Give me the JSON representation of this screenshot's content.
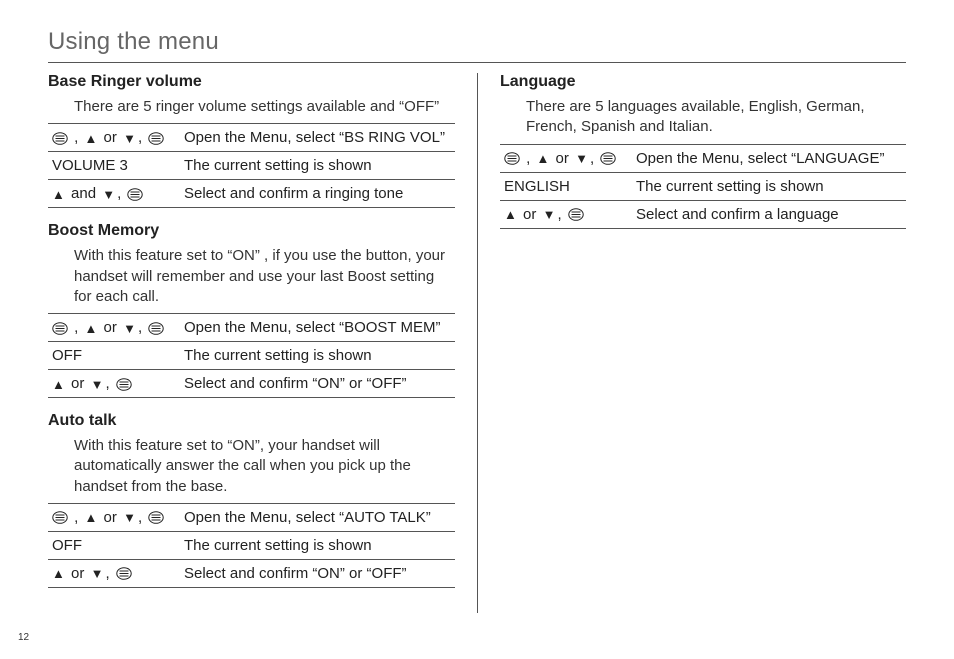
{
  "title": "Using the menu",
  "page_number": "12",
  "left": {
    "sections": [
      {
        "heading": "Base Ringer volume",
        "desc": "There are 5 ringer volume settings available and “OFF”",
        "rows": [
          {
            "key_pattern": "menu-updown-menu",
            "action": "Open the Menu, select “BS RING VOL”"
          },
          {
            "key_text": "VOLUME 3",
            "action": "The current setting is shown"
          },
          {
            "key_pattern": "up-and-down-menu",
            "action": "Select and confirm a ringing tone"
          }
        ]
      },
      {
        "heading": "Boost Memory",
        "desc": "With this feature set to “ON” , if you use the button, your handset will remember and use your last Boost setting for each call.",
        "rows": [
          {
            "key_pattern": "menu-updown-menu",
            "action": "Open the Menu, select “BOOST MEM”"
          },
          {
            "key_text": "OFF",
            "action": "The current setting is shown"
          },
          {
            "key_pattern": "updown-menu",
            "action": "Select and confirm “ON” or “OFF”"
          }
        ]
      },
      {
        "heading": "Auto talk",
        "desc": "With this feature set to “ON”, your handset will automatically answer the call when you pick up the handset from the base.",
        "rows": [
          {
            "key_pattern": "menu-updown-menu",
            "action": "Open the Menu, select “AUTO TALK”"
          },
          {
            "key_text": "OFF",
            "action": "The current setting is shown"
          },
          {
            "key_pattern": "updown-menu",
            "action": "Select and confirm “ON” or “OFF”"
          }
        ]
      }
    ]
  },
  "right": {
    "sections": [
      {
        "heading": "Language",
        "desc": "There are 5 languages available, English, German, French, Spanish and Italian.",
        "rows": [
          {
            "key_pattern": "menu-updown-menu",
            "action": "Open the Menu, select “LANGUAGE”"
          },
          {
            "key_text": "ENGLISH",
            "action": "The current setting is shown"
          },
          {
            "key_pattern": "updown-menu",
            "action": "Select and confirm a language"
          }
        ]
      }
    ]
  },
  "labels": {
    "or": "or",
    "and": "and",
    "comma": ","
  }
}
